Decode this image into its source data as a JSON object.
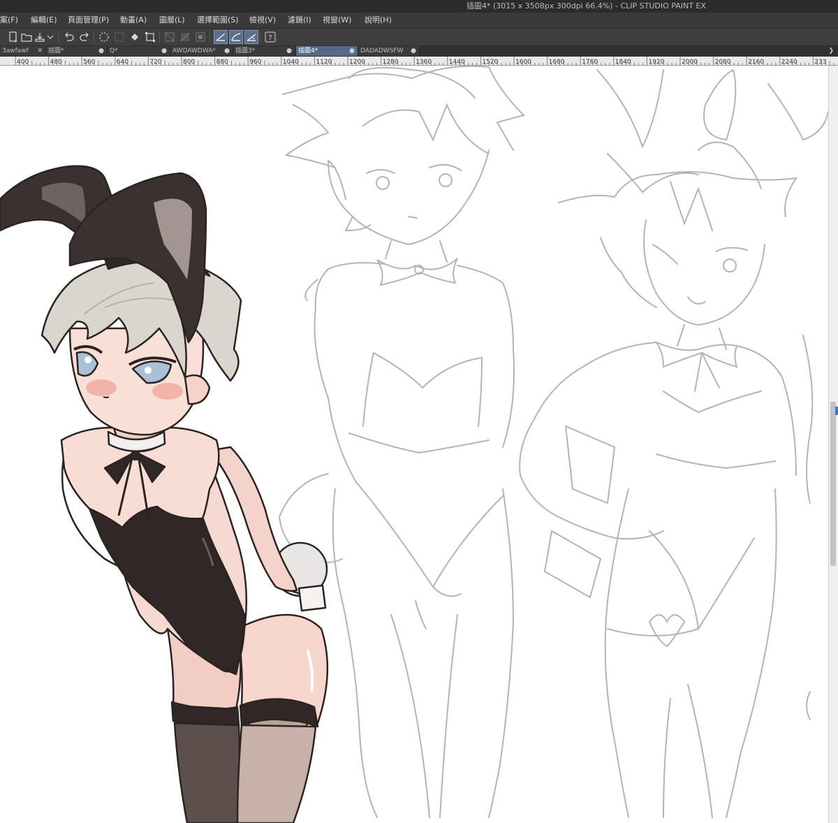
{
  "window": {
    "title": "插圖4* (3015 x 3508px 300dpi 66.4%)  - CLIP STUDIO PAINT EX"
  },
  "menu": {
    "items": [
      {
        "label": "案(F)"
      },
      {
        "label": "編輯(E)"
      },
      {
        "label": "頁面管理(P)"
      },
      {
        "label": "動畫(A)"
      },
      {
        "label": "圖層(L)"
      },
      {
        "label": "選擇範圍(S)"
      },
      {
        "label": "檢視(V)"
      },
      {
        "label": "濾鏡(I)"
      },
      {
        "label": "視窗(W)"
      },
      {
        "label": "說明(H)"
      }
    ]
  },
  "toolbar": {
    "icons": [
      "new-file-icon",
      "open-file-icon",
      "save-icon",
      "dropdown-arrow-icon",
      "undo-icon",
      "redo-icon",
      "loading-spinner-icon",
      "select-all-icon",
      "fill-icon",
      "transform-icon",
      "clear-icon",
      "clear-outside-icon",
      "crop-icon",
      "snap-ruler-icon",
      "snap-special-ruler-icon",
      "snap-grid-icon",
      "help-icon"
    ]
  },
  "tabs": [
    {
      "label": "3awfawf",
      "active": false
    },
    {
      "label": "插圖*",
      "active": false
    },
    {
      "label": "Q*",
      "active": false
    },
    {
      "label": "AWDAWDWA*",
      "active": false
    },
    {
      "label": "插圖3*",
      "active": false
    },
    {
      "label": "插圖4*",
      "active": true
    },
    {
      "label": "DADADWSFW",
      "active": false
    }
  ],
  "ruler": {
    "ticks": [
      "400",
      "480",
      "560",
      "640",
      "720",
      "800",
      "880",
      "960",
      "1040",
      "1120",
      "1200",
      "1280",
      "1360",
      "1440",
      "1520",
      "1600",
      "1680",
      "1760",
      "1840",
      "1920",
      "2000",
      "2080",
      "2160",
      "2240",
      "233"
    ]
  },
  "colors": {
    "titlebar": "#2b2b2b",
    "menubar": "#3a3a3a",
    "toolbar": "#3e3e3e",
    "active_tab": "#536a8c",
    "sketch_line": "#b4b4b4",
    "suit": "#2f2827",
    "hair": "#d9d4cc",
    "skin": "#f7dcd3"
  }
}
